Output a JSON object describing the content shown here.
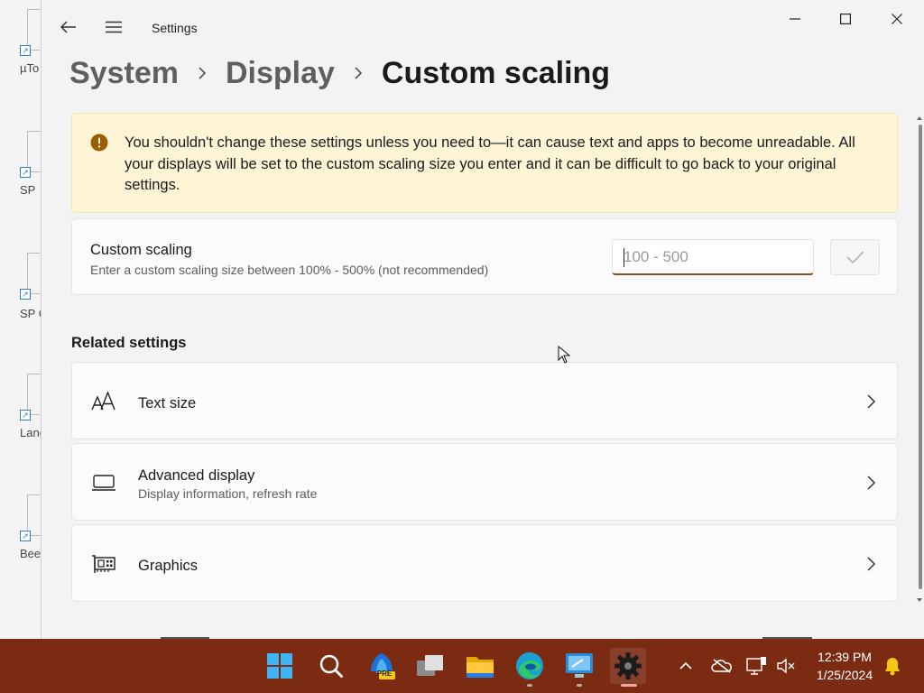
{
  "window": {
    "app_title": "Settings",
    "controls": {
      "minimize": "minimize",
      "maximize": "maximize",
      "close": "close"
    }
  },
  "breadcrumb": {
    "items": [
      "System",
      "Display"
    ],
    "current": "Custom scaling"
  },
  "warning": {
    "text": "You shouldn't change these settings unless you need to—it can cause text and apps to become unreadable. All your displays will be set to the custom scaling size you enter and it can be difficult to go back to your original settings."
  },
  "custom_scaling": {
    "title": "Custom scaling",
    "description": "Enter a custom scaling size between 100% - 500% (not recommended)",
    "input_value": "",
    "input_placeholder": "100 - 500"
  },
  "related": {
    "heading": "Related settings",
    "items": [
      {
        "title": "Text size",
        "subtitle": "",
        "icon": "text-size-icon"
      },
      {
        "title": "Advanced display",
        "subtitle": "Display information, refresh rate",
        "icon": "monitor-icon"
      },
      {
        "title": "Graphics",
        "subtitle": "",
        "icon": "graphics-card-icon"
      }
    ]
  },
  "desktop_icons": [
    {
      "label": "µTo"
    },
    {
      "label": "SP"
    },
    {
      "label": "SP Gala"
    },
    {
      "label": "Lang"
    },
    {
      "label": "Bee"
    }
  ],
  "taskbar": {
    "apps": [
      {
        "name": "start-icon"
      },
      {
        "name": "search-icon"
      },
      {
        "name": "outlook-pre-icon",
        "badge": "PRE"
      },
      {
        "name": "task-view-icon"
      },
      {
        "name": "file-explorer-icon"
      },
      {
        "name": "edge-icon"
      },
      {
        "name": "remote-desktop-icon"
      },
      {
        "name": "settings-gear-icon"
      }
    ],
    "time": "12:39 PM",
    "date": "1/25/2024"
  },
  "colors": {
    "taskbar": "#7a2b12",
    "warning_bg": "#fdf5d5",
    "warning_icon": "#9d5d00",
    "input_accent": "#8a4a2a"
  }
}
